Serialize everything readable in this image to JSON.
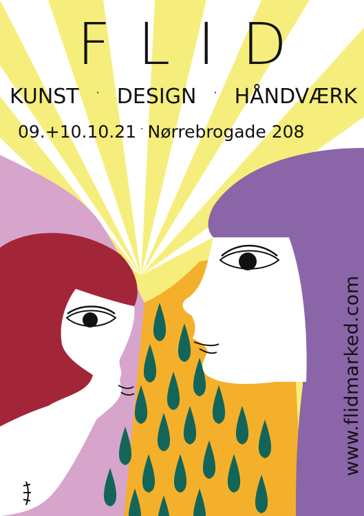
{
  "poster": {
    "title": "FLID",
    "tagline": [
      "KUNST",
      "DESIGN",
      "HÅNDVÆRK"
    ],
    "separator": "·",
    "dates": "09.+10.10.21",
    "address": "Nørrebrogade 208",
    "website": "www.flidmarked.com"
  },
  "colors": {
    "yellow": "#f6ee7c",
    "pale_yellow": "#fbf7b5",
    "lilac": "#d7a5cc",
    "purple": "#8a66a8",
    "red_hair": "#a32638",
    "orange": "#f4b02b",
    "green": "#13655a",
    "ink": "#111111"
  }
}
